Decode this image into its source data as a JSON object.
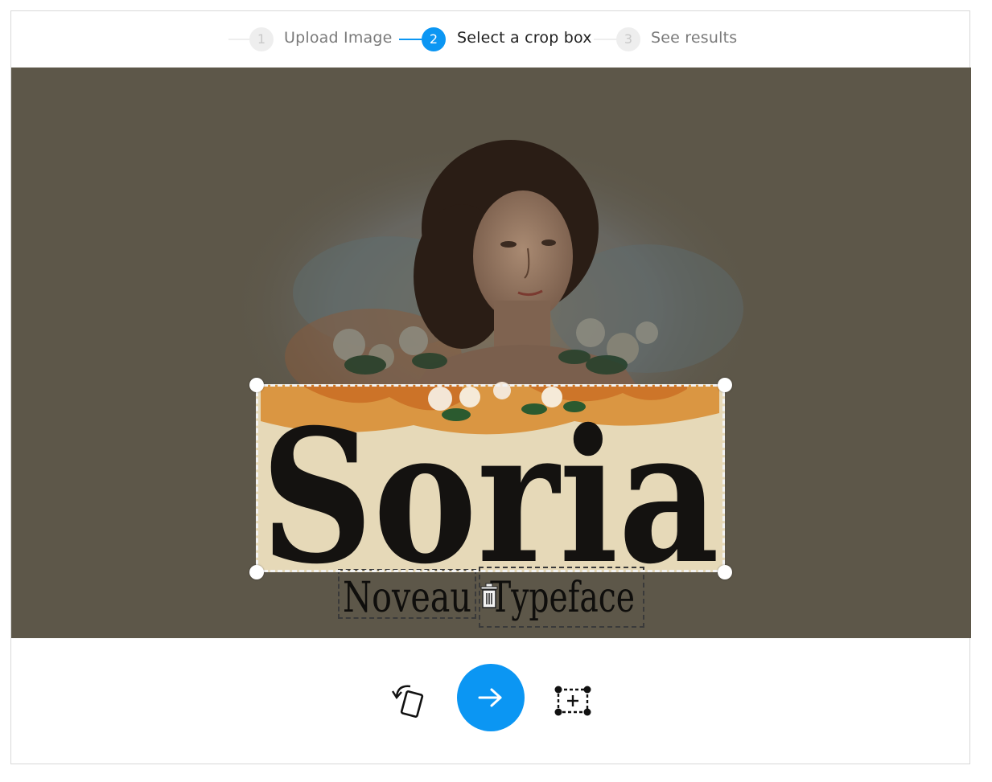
{
  "stepper": {
    "steps": [
      {
        "number": "1",
        "label": "Upload Image",
        "state": "done"
      },
      {
        "number": "2",
        "label": "Select a crop box",
        "state": "active"
      },
      {
        "number": "3",
        "label": "See results",
        "state": "pending"
      }
    ]
  },
  "image": {
    "headline": "Soria",
    "subline_word_1": "Noveau",
    "subline_word_2": "Typeface"
  },
  "toolbar": {
    "rotate_icon": "rotate-icon",
    "next_icon": "arrow-right-icon",
    "add_crop_icon": "add-crop-box-icon"
  },
  "colors": {
    "accent": "#0b96f3",
    "canvas_bg": "#5d5749",
    "poster_bg": "#e6d9b8"
  }
}
